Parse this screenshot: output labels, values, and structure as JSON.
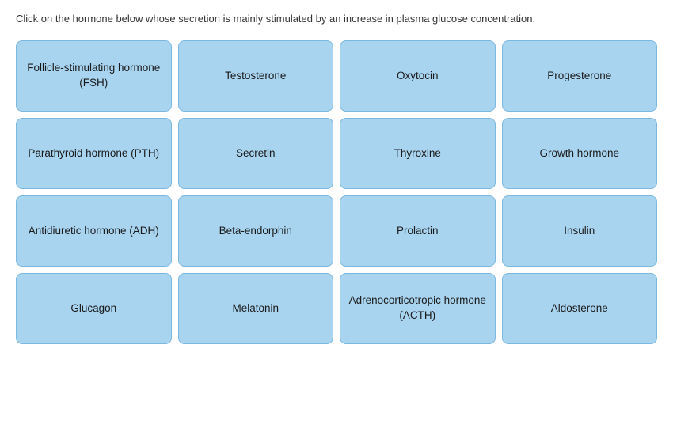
{
  "instruction": "Click on the hormone below whose secretion is mainly stimulated by an increase in plasma glucose concentration.",
  "grid": {
    "cells": [
      {
        "id": "fsh",
        "label": "Follicle-stimulating hormone (FSH)"
      },
      {
        "id": "testosterone",
        "label": "Testosterone"
      },
      {
        "id": "oxytocin",
        "label": "Oxytocin"
      },
      {
        "id": "progesterone",
        "label": "Progesterone"
      },
      {
        "id": "pth",
        "label": "Parathyroid hormone (PTH)"
      },
      {
        "id": "secretin",
        "label": "Secretin"
      },
      {
        "id": "thyroxine",
        "label": "Thyroxine"
      },
      {
        "id": "growth-hormone",
        "label": "Growth hormone"
      },
      {
        "id": "adh",
        "label": "Antidiuretic hormone (ADH)"
      },
      {
        "id": "beta-endorphin",
        "label": "Beta-endorphin"
      },
      {
        "id": "prolactin",
        "label": "Prolactin"
      },
      {
        "id": "insulin",
        "label": "Insulin"
      },
      {
        "id": "glucagon",
        "label": "Glucagon"
      },
      {
        "id": "melatonin",
        "label": "Melatonin"
      },
      {
        "id": "acth",
        "label": "Adrenocorticotropic hormone (ACTH)"
      },
      {
        "id": "aldosterone",
        "label": "Aldosterone"
      }
    ]
  }
}
